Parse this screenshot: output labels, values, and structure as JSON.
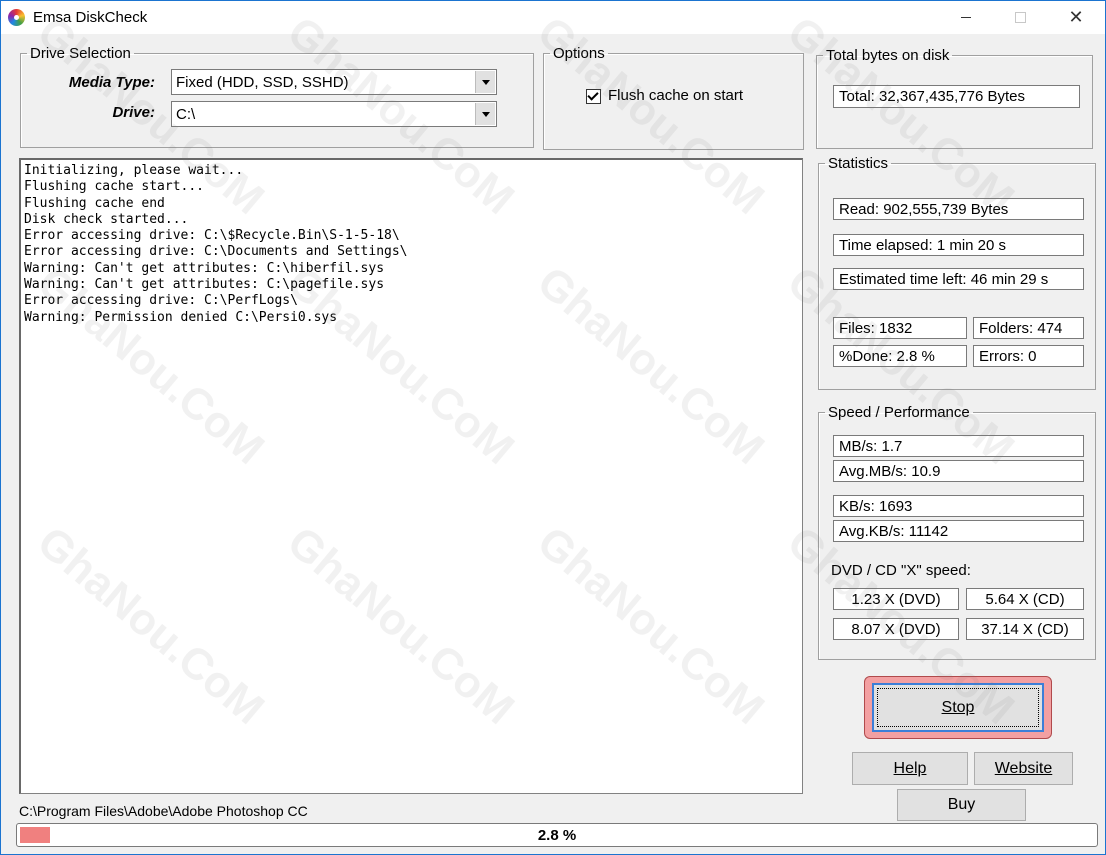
{
  "window": {
    "title": "Emsa DiskCheck"
  },
  "drive_selection": {
    "legend": "Drive Selection",
    "media_type_label": "Media Type:",
    "media_type_value": "Fixed (HDD, SSD, SSHD)",
    "drive_label": "Drive:",
    "drive_value": "C:\\"
  },
  "options": {
    "legend": "Options",
    "flush_cache_label": "Flush cache on start",
    "flush_cache_checked": true
  },
  "total_bytes": {
    "legend": "Total bytes on disk",
    "value": "Total: 32,367,435,776 Bytes"
  },
  "log": {
    "lines": [
      "Initializing, please wait...",
      "Flushing cache start...",
      "Flushing cache end",
      "Disk check started...",
      "Error accessing drive: C:\\$Recycle.Bin\\S-1-5-18\\",
      "Error accessing drive: C:\\Documents and Settings\\",
      "Warning: Can't get attributes: C:\\hiberfil.sys",
      "Warning: Can't get attributes: C:\\pagefile.sys",
      "Error accessing drive: C:\\PerfLogs\\",
      "Warning: Permission denied C:\\Persi0.sys"
    ]
  },
  "statistics": {
    "legend": "Statistics",
    "read": "Read: 902,555,739 Bytes",
    "time_elapsed": "Time elapsed: 1 min 20 s",
    "time_left": "Estimated time left: 46 min 29 s",
    "files": "Files:  1832",
    "folders": "Folders:  474",
    "percent_done": "%Done:  2.8 %",
    "errors": "Errors:  0"
  },
  "speed": {
    "legend": "Speed / Performance",
    "mbs": "MB/s: 1.7",
    "avg_mbs": "Avg.MB/s: 10.9",
    "kbs": "KB/s: 1693",
    "avg_kbs": "Avg.KB/s: 11142",
    "dvd_cd_label": "DVD / CD \"X\" speed:",
    "dvd1": "1.23 X (DVD)",
    "cd1": "5.64 X (CD)",
    "dvd2": "8.07 X (DVD)",
    "cd2": "37.14 X (CD)"
  },
  "buttons": {
    "stop": "Stop",
    "help": "Help",
    "website": "Website",
    "buy": "Buy"
  },
  "status": {
    "current_path": "C:\\Program Files\\Adobe\\Adobe Photoshop CC",
    "progress_text": "2.8 %",
    "progress_fraction": 0.028
  },
  "watermark": {
    "text": "GhaNou.CoM"
  },
  "colors": {
    "progress_fill": "#f0807f",
    "stop_frame": "#f3a0a2",
    "title_border": "#1b74d0"
  }
}
